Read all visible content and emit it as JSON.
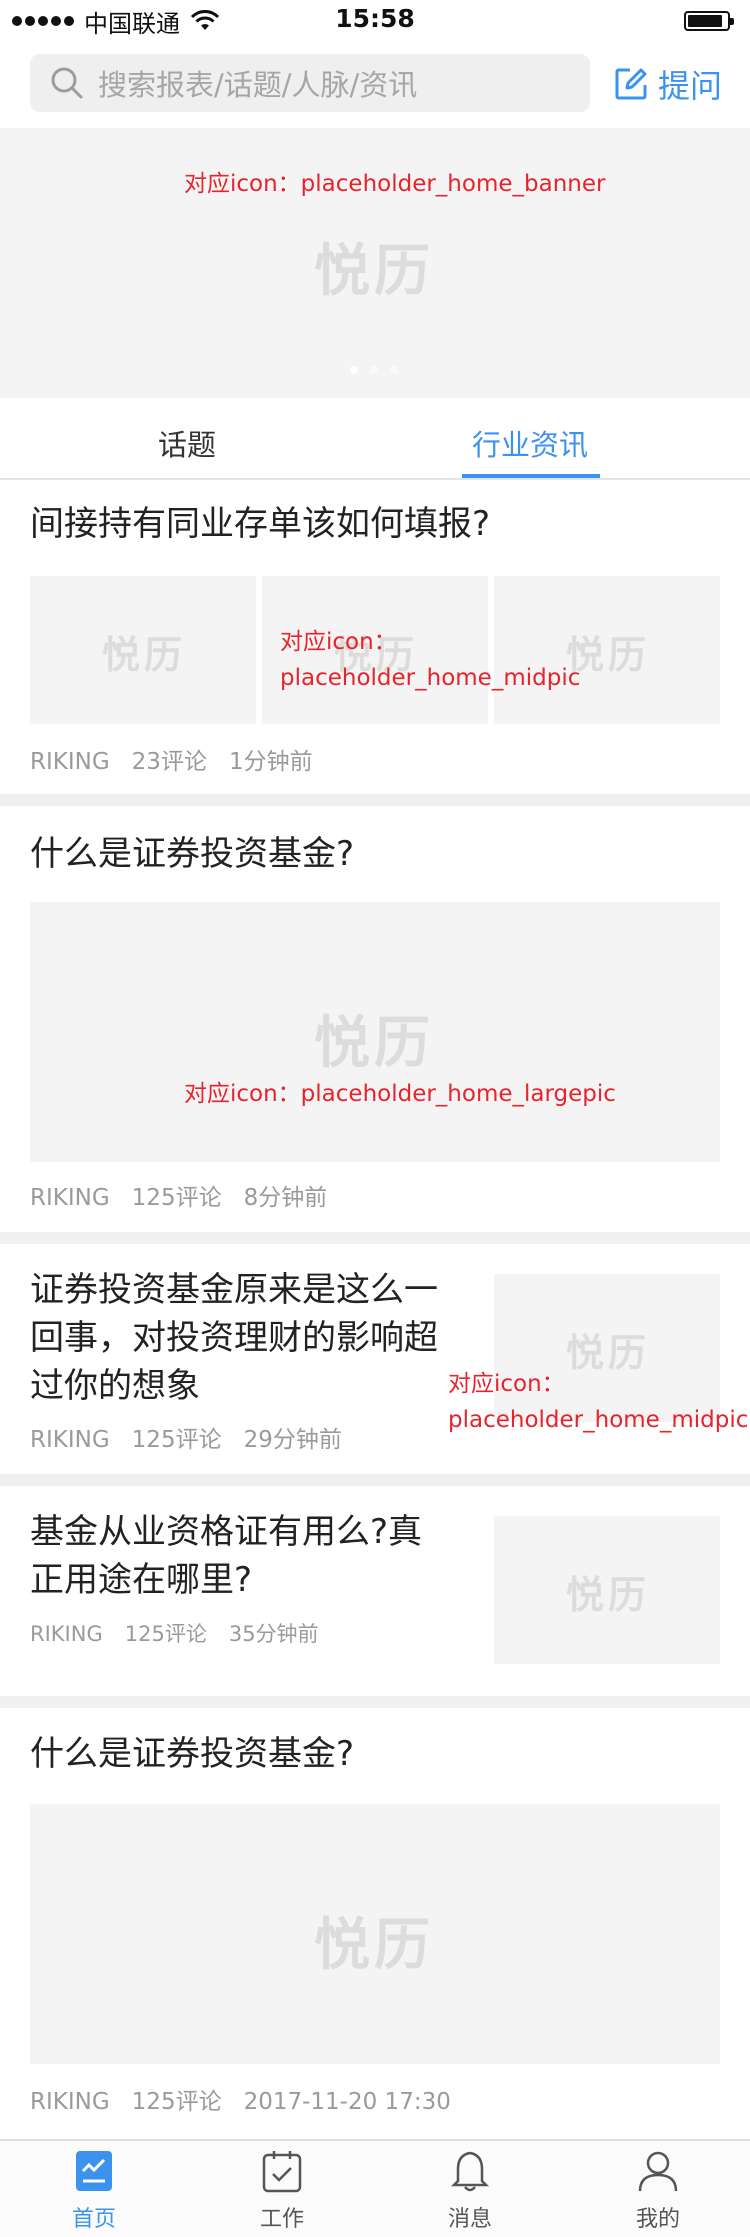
{
  "status_bar": {
    "carrier": "中国联通",
    "time": "15:58"
  },
  "search": {
    "placeholder": "搜索报表/话题/人脉/资讯",
    "ask_label": "提问"
  },
  "banner": {
    "note": "对应icon：placeholder_home_banner",
    "watermark": "悦历",
    "page_count": 3,
    "active_page": 1
  },
  "tabs": [
    {
      "label": "话题"
    },
    {
      "label": "行业资讯"
    }
  ],
  "active_tab": 1,
  "feed": [
    {
      "title": "间接持有同业存单该如何填报?",
      "note_line1": "对应icon：",
      "note_line2": "placeholder_home_midpic",
      "watermark": "悦历",
      "author": "RIKING",
      "comments": "23评论",
      "time": "1分钟前"
    },
    {
      "title": "什么是证券投资基金?",
      "note": "对应icon：placeholder_home_largepic",
      "watermark": "悦历",
      "author": "RIKING",
      "comments": "125评论",
      "time": "8分钟前"
    },
    {
      "title_line1": "证券投资基金原来是这么一",
      "title_line2": "回事，对投资理财的影响超",
      "title_line3": "过你的想象",
      "note_line1": "对应icon：",
      "note_line2": "placeholder_home_midpic",
      "watermark": "悦历",
      "author": "RIKING",
      "comments": "125评论",
      "time": "29分钟前"
    },
    {
      "title_line1": "基金从业资格证有用么?真",
      "title_line2": "正用途在哪里?",
      "watermark": "悦历",
      "author": "RIKING",
      "comments": "125评论",
      "time": "35分钟前"
    },
    {
      "title": "什么是证券投资基金?",
      "watermark": "悦历",
      "author": "RIKING",
      "comments": "125评论",
      "time": "2017-11-20 17:30"
    }
  ],
  "tabbar": [
    {
      "label": "首页",
      "icon": "home-icon",
      "active": true
    },
    {
      "label": "工作",
      "icon": "calendar-icon",
      "active": false
    },
    {
      "label": "消息",
      "icon": "bell-icon",
      "active": false
    },
    {
      "label": "我的",
      "icon": "user-icon",
      "active": false
    }
  ],
  "colors": {
    "accent": "#3b93ef",
    "annotation": "#e8232b",
    "placeholder_bg": "#f4f4f4",
    "watermark": "#dcdcdc"
  }
}
